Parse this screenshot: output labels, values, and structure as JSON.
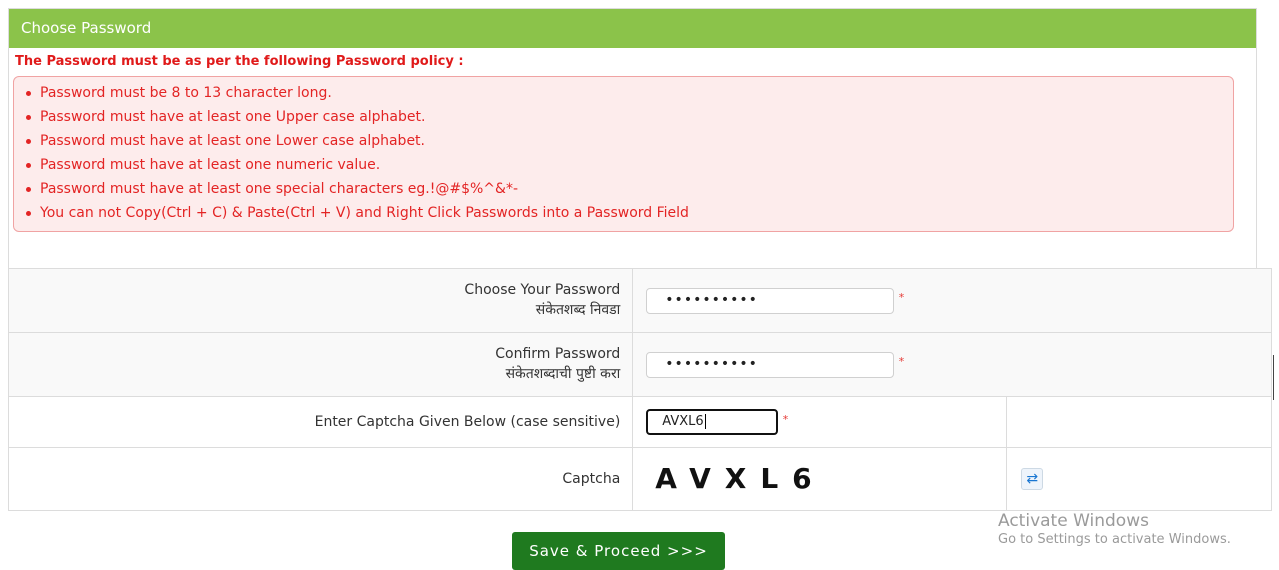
{
  "panel": {
    "title": "Choose Password",
    "header_color": "#8bc34a"
  },
  "policy": {
    "title": "The Password must be as per the following Password policy :",
    "items": [
      "Password must be 8 to 13 character long.",
      "Password must have at least one Upper case alphabet.",
      "Password must have at least one Lower case alphabet.",
      "Password must have at least one numeric value.",
      "Password must have at least one special characters eg.!@#$%^&*-",
      "You can not Copy(Ctrl + C) & Paste(Ctrl + V) and Right Click Passwords into a Password Field"
    ]
  },
  "form": {
    "choose_password": {
      "label_en": "Choose Your Password",
      "label_mr": "संकेतशब्द निवडा",
      "value": "••••••••••",
      "required": "*"
    },
    "confirm_password": {
      "label_en": "Confirm Password",
      "label_mr": "संकेतशब्दाची पुष्टी करा",
      "value": "••••••••••",
      "required": "*"
    },
    "captcha_entry": {
      "label": "Enter Captcha Given Below (case sensitive)",
      "value": "AVXL6",
      "required": "*"
    },
    "captcha": {
      "label": "Captcha",
      "image_text": "AVXL6",
      "refresh_icon": "refresh-icon"
    }
  },
  "save_button": "Save & Proceed >>>",
  "watermark": {
    "line1": "Activate Windows",
    "line2": "Go to Settings to activate Windows."
  }
}
